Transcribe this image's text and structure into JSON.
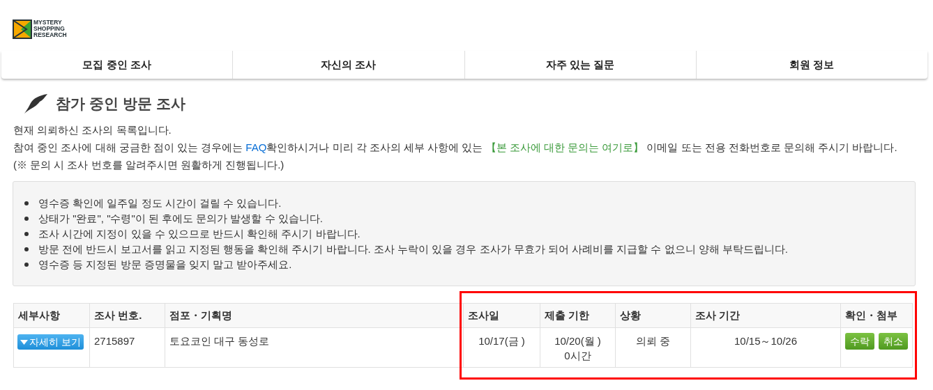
{
  "logo": {
    "lines": [
      "MYSTERY",
      "SHOPPING",
      "RESEARCH"
    ]
  },
  "nav": [
    "모집 중인 조사",
    "자신의 조사",
    "자주 있는 질문",
    "회원 정보"
  ],
  "page_title": "참가 중인 방문 조사",
  "intro": {
    "line": "현재 의뢰하신 조사의 목록입니다.",
    "before_faq": "참여 중인 조사에 대해 궁금한 점이 있는 경우에는 ",
    "faq_link": "FAQ",
    "middle": "확인하시거나 미리 각 조사의 세부 사항에 있는 ",
    "contact_link": "【본 조사에 대한 문의는 여기로】",
    "after": " 이메일 또는 전용 전화번호로 문의해 주시기 바랍니다. (※ 문의 시 조사 번호를 알려주시면 원활하게 진행됩니다.)"
  },
  "notices": [
    "영수증 확인에 일주일 정도 시간이 걸릴 수 있습니다.",
    "상태가 \"완료\", \"수령\"이 된 후에도 문의가 발생할 수 있습니다.",
    "조사 시간에 지정이 있을 수 있으므로 반드시 확인해 주시기 바랍니다.",
    "방문 전에 반드시 보고서를 읽고 지정된 행동을 확인해 주시기 바랍니다. 조사 누락이 있을 경우 조사가 무효가 되어 사례비를 지급할 수 없으니 양해 부탁드립니다.",
    "영수증 등 지정된 방문 증명물을 잊지 말고 받아주세요."
  ],
  "table": {
    "columns": [
      "세부사항",
      "조사 번호.",
      "점포・기획명",
      "조사일",
      "제출 기한",
      "상황",
      "조사 기간",
      "확인・첨부"
    ],
    "rows": [
      {
        "details_button": "자세히 보기",
        "number": "2715897",
        "store": "토요코인 대구 동성로",
        "survey_date": "10/17(금 )",
        "deadline": [
          "10/20(월 )",
          "0시간"
        ],
        "status": "의뢰 중",
        "period": "10/15～10/26",
        "actions": [
          "수락",
          "취소"
        ]
      }
    ]
  },
  "highlight": {
    "kind": "frame"
  }
}
